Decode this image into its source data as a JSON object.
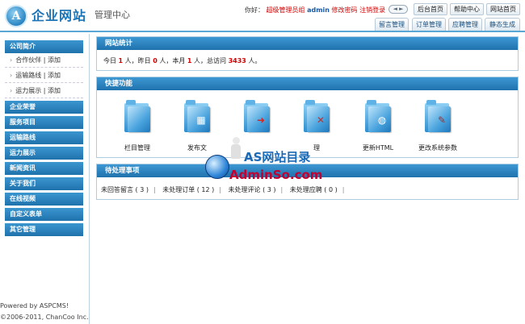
{
  "header": {
    "logo_letter": "A",
    "site_title": "企业网站",
    "site_sub": "管理中心",
    "greeting": "你好：",
    "role": "超级管理员组",
    "username": "admin",
    "link_change_pwd": "修改密码",
    "link_logout": "注销登录",
    "toggle_glyph": "◄ ►",
    "btn_admin_home": "后台首页",
    "btn_help": "帮助中心",
    "btn_site_home": "网站首页",
    "tabs": [
      "留言管理",
      "订单管理",
      "应聘管理",
      "静态生成"
    ]
  },
  "sidebar": {
    "sections": [
      {
        "label": "公司简介",
        "items": [
          "合作伙伴 | 添加",
          "运输路线 | 添加",
          "运力展示 | 添加"
        ]
      },
      {
        "label": "企业荣誉"
      },
      {
        "label": "服务项目"
      },
      {
        "label": "运输路线"
      },
      {
        "label": "运力展示"
      },
      {
        "label": "新闻资讯"
      },
      {
        "label": "关于我们"
      },
      {
        "label": "在线视频"
      },
      {
        "label": "自定义表单"
      },
      {
        "label": "其它管理"
      }
    ],
    "footer_powered": "Powered by ASPCMS!",
    "footer_copyright": "©2006-2011, ChanCoo Inc."
  },
  "stats": {
    "title": "网站统计",
    "today_label": "今日",
    "today_count": "1",
    "yesterday_label": "人，昨日",
    "yesterday_count": "0",
    "month_label": "人，本月",
    "month_count": "1",
    "total_label": "人，总访问",
    "total_count": "3433",
    "suffix": "人。"
  },
  "quick": {
    "title": "快捷功能",
    "items": [
      {
        "label": "栏目管理",
        "icon": "folder-icon"
      },
      {
        "label": "发布文",
        "icon": "folder-image-icon"
      },
      {
        "label": "",
        "icon": "folder-arrow-icon"
      },
      {
        "label": "理",
        "icon": "folder-tools-icon"
      },
      {
        "label": "更新HTML",
        "icon": "folder-globe-icon"
      },
      {
        "label": "更改系统参数",
        "icon": "folder-settings-icon"
      }
    ]
  },
  "pending": {
    "title": "待处理事项",
    "items": [
      "未回答留言 ( 3 )",
      "未处理订单 ( 12 )",
      "未处理评论 ( 3 )",
      "未处理应聘 ( 0 )"
    ]
  },
  "watermark": {
    "line1": "AS网站目录",
    "line2": "AdminSo.com"
  },
  "colors": {
    "accent": "#1f73ad",
    "highlight_red": "#d40000",
    "panel_border": "#aecde3"
  }
}
